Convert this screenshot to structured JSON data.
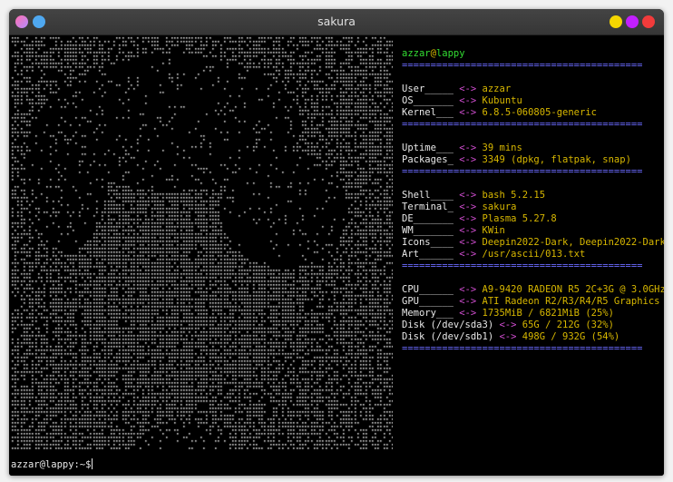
{
  "window": {
    "title": "sakura"
  },
  "info": {
    "user": "azzar",
    "at": "@",
    "host": "lappy",
    "separator": "==========================================",
    "arrow": "<->",
    "groups": [
      [
        {
          "key": "User_____",
          "value": "azzar"
        },
        {
          "key": "OS_______",
          "value": "Kubuntu"
        },
        {
          "key": "Kernel___",
          "value": "6.8.5-060805-generic"
        }
      ],
      [
        {
          "key": "Uptime___",
          "value": "39 mins"
        },
        {
          "key": "Packages_",
          "value": "3349 (dpkg, flatpak, snap)"
        }
      ],
      [
        {
          "key": "Shell____",
          "value": "bash 5.2.15"
        },
        {
          "key": "Terminal_",
          "value": "sakura"
        },
        {
          "key": "DE_______",
          "value": "Plasma 5.27.8"
        },
        {
          "key": "WM_______",
          "value": "KWin"
        },
        {
          "key": "Icons____",
          "value": "Deepin2022-Dark, Deepin2022-Dark"
        },
        {
          "key": "Art______",
          "value": "/usr/ascii/013.txt"
        }
      ],
      [
        {
          "key": "CPU______",
          "value": "A9-9420 RADEON R5 2C+3G @ 3.0GHz"
        },
        {
          "key": "GPU______",
          "value": "ATI Radeon R2/R3/R4/R5 Graphics"
        },
        {
          "key": "Memory___",
          "value": "1735MiB / 6821MiB (25%)"
        },
        {
          "key": "Disk (/dev/sda3)",
          "value": "65G / 212G (32%)"
        },
        {
          "key": "Disk (/dev/sdb1)",
          "value": "498G / 932G (54%)"
        }
      ]
    ]
  },
  "prompt": {
    "text": "azzar@lappy:~$"
  },
  "colors": {
    "background": "#000000",
    "username": "#33dd33",
    "value": "#d7b700",
    "arrow": "#d04dd0",
    "separator": "#6a6aff",
    "ascii_art": "#dddddd"
  }
}
